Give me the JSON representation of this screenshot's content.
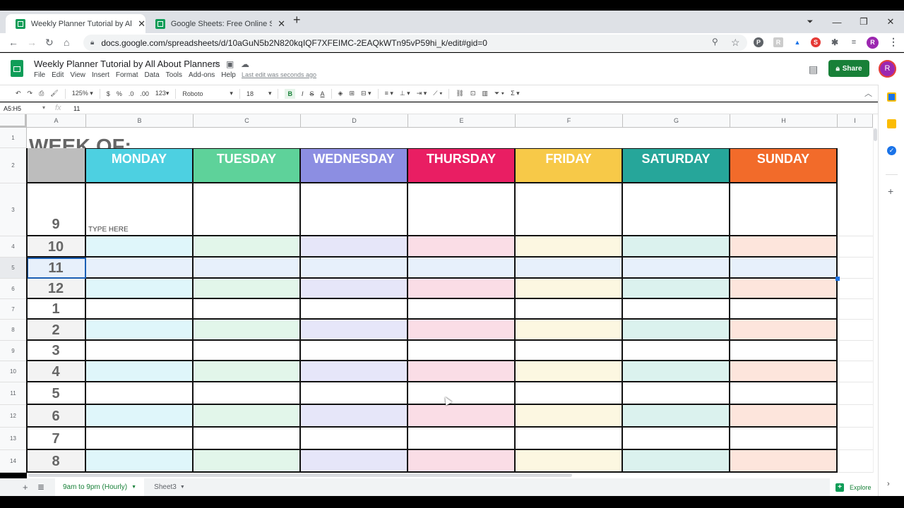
{
  "browser": {
    "tabs": [
      {
        "title": "Weekly Planner Tutorial by All About Planners",
        "active": true
      },
      {
        "title": "Google Sheets: Free Online Spreadsheet Editor",
        "active": false
      }
    ],
    "url": "docs.google.com/spreadsheets/d/10aGuN5b2N820kqIQF7XFEIMC-2EAQkWTn95vP59hi_k/edit#gid=0",
    "profile_initial": "R",
    "window_controls": {
      "minimize": "—",
      "restore": "❐",
      "close": "✕"
    }
  },
  "doc": {
    "title": "Weekly Planner Tutorial by All About Planners",
    "menus": [
      "File",
      "Edit",
      "View",
      "Insert",
      "Format",
      "Data",
      "Tools",
      "Add-ons",
      "Help"
    ],
    "last_edit": "Last edit was seconds ago",
    "share_label": "Share",
    "avatar_initial": "R"
  },
  "toolbar": {
    "zoom": "125%",
    "currency": "$",
    "percent": "%",
    "dec_decrease": ".0",
    "dec_increase": ".00",
    "format": "123",
    "font": "Roboto",
    "font_size": "18",
    "bold": "B",
    "italic": "I",
    "strike": "S",
    "text_color": "A"
  },
  "formula_bar": {
    "name_box": "A5:H5",
    "fx": "fx",
    "value": "11"
  },
  "grid": {
    "columns": [
      "A",
      "B",
      "C",
      "D",
      "E",
      "F",
      "G",
      "H",
      "I"
    ],
    "row_numbers": [
      "1",
      "2",
      "3",
      "4",
      "5",
      "6",
      "7",
      "8",
      "9",
      "10",
      "11",
      "12",
      "13",
      "14"
    ],
    "title": "WEEK OF:",
    "days": [
      {
        "label": "MONDAY",
        "color": "#4dd0e1",
        "tint": "#dff6fa"
      },
      {
        "label": "TUESDAY",
        "color": "#5ed29a",
        "tint": "#e2f6ea"
      },
      {
        "label": "WEDNESDAY",
        "color": "#8c8ee2",
        "tint": "#e6e6f9"
      },
      {
        "label": "THURSDAY",
        "color": "#e91e63",
        "tint": "#fadde6"
      },
      {
        "label": "FRIDAY",
        "color": "#f7c948",
        "tint": "#fcf7e1"
      },
      {
        "label": "SATURDAY",
        "color": "#26a69a",
        "tint": "#dbf2ee"
      },
      {
        "label": "SUNDAY",
        "color": "#f26b2a",
        "tint": "#fde5dc"
      }
    ],
    "hours": [
      "9",
      "10",
      "11",
      "12",
      "1",
      "2",
      "3",
      "4",
      "5",
      "6",
      "7",
      "8"
    ],
    "placeholder_cell": "TYPE HERE",
    "selected_row": "5",
    "selection_color": "#e7f0fb"
  },
  "sheets": {
    "tabs": [
      {
        "label": "9am to 9pm (Hourly)",
        "active": true
      },
      {
        "label": "Sheet3",
        "active": false
      }
    ],
    "explore_label": "Explore"
  }
}
